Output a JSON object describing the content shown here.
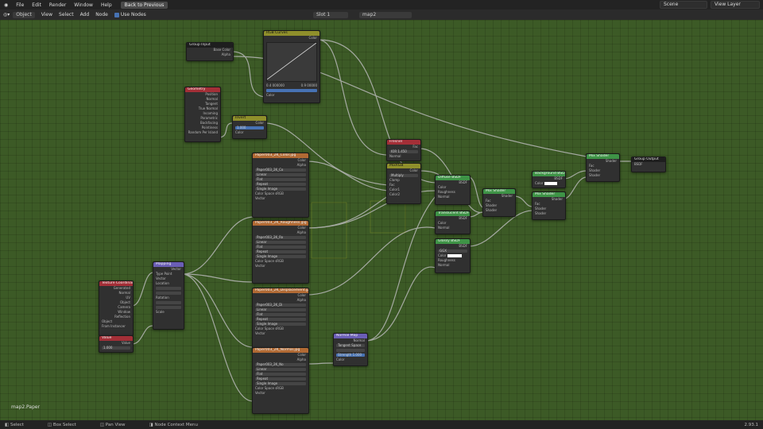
{
  "menu": {
    "items": [
      "File",
      "Edit",
      "Render",
      "Window",
      "Help"
    ],
    "back_button": "Back to Previous"
  },
  "topright": {
    "scene": "Scene",
    "view_layer": "View Layer"
  },
  "header": {
    "mode": "Object",
    "items": [
      "View",
      "Select",
      "Add",
      "Node"
    ],
    "use_nodes": "Use Nodes",
    "slot": "Slot 1",
    "material": "map2"
  },
  "nodes": {
    "group_input": {
      "title": "Group Input",
      "rows": [
        "Base Color",
        "Alpha"
      ]
    },
    "rgb_curves": {
      "title": "RGB Curves",
      "rows": [
        "Color",
        "Fac",
        "Color"
      ],
      "left": "0.4 000000",
      "right": "0.9 00000"
    },
    "geometry": {
      "title": "Geometry",
      "rows": [
        "Position",
        "Normal",
        "Tangent",
        "True Normal",
        "Incoming",
        "Parametric",
        "Backfacing",
        "Pointiness",
        "Random Per Island"
      ]
    },
    "invert": {
      "title": "Invert",
      "rows": [
        "Color",
        "Fac",
        "Color"
      ],
      "fac": "1.000"
    },
    "tex1": {
      "title": "Paper003_2K_Color.jpg",
      "rows": [
        "Color",
        "Alpha",
        "Paper003_2K_Co",
        "Linear",
        "Flat",
        "Repeat",
        "Single Image",
        "Color Space",
        "sRGB",
        "Vector"
      ]
    },
    "tex2": {
      "title": "Paper003_2K_Roughness.jpg",
      "rows": [
        "Color",
        "Alpha",
        "Paper003_2K_Ro",
        "Linear",
        "Flat",
        "Repeat",
        "Single Image",
        "Color Space",
        "sRGB",
        "Vector"
      ]
    },
    "tex3": {
      "title": "Paper003_2K_Displacement.jpg",
      "rows": [
        "Color",
        "Alpha",
        "Paper003_2K_Di",
        "Linear",
        "Flat",
        "Repeat",
        "Single Image",
        "Color Space",
        "sRGB",
        "Vector"
      ]
    },
    "tex4": {
      "title": "Paper003_2K_Normal.jpg",
      "rows": [
        "Color",
        "Alpha",
        "Paper003_2K_No",
        "Linear",
        "Flat",
        "Repeat",
        "Single Image",
        "Color Space",
        "sRGB",
        "Vector"
      ]
    },
    "texcoord": {
      "title": "Texture Coordinate",
      "rows": [
        "Generated",
        "Normal",
        "UV",
        "Object",
        "Camera",
        "Window",
        "Reflection",
        "Object",
        "From Instancer"
      ]
    },
    "value": {
      "title": "Value",
      "rows": [
        "Value",
        "1.000"
      ]
    },
    "mapping": {
      "title": "Mapping",
      "rows": [
        "Vector",
        "Type",
        "Point",
        "Vector",
        "Location",
        "Rotation",
        "Scale"
      ]
    },
    "fresnel": {
      "title": "Fresnel",
      "rows": [
        "Fac",
        "IOR",
        "1.450",
        "Normal"
      ]
    },
    "mixrgb": {
      "title": "MixRGB",
      "rows": [
        "Color",
        "Multiply",
        "Clamp",
        "Fac",
        "Color1",
        "Color2"
      ]
    },
    "diffuse": {
      "title": "Diffuse BSDF",
      "rows": [
        "BSDF",
        "Color",
        "Roughness",
        "Normal"
      ]
    },
    "translucent": {
      "title": "Translucent BSDF",
      "rows": [
        "BSDF",
        "Color",
        "Normal"
      ]
    },
    "glossy": {
      "title": "Glossy BSDF",
      "rows": [
        "BSDF",
        "GGX",
        "Color",
        "Roughness",
        "Normal"
      ]
    },
    "mix1": {
      "title": "Mix Shader",
      "rows": [
        "Shader",
        "Fac",
        "Shader",
        "Shader"
      ]
    },
    "mix2": {
      "title": "Mix Shader",
      "rows": [
        "Shader",
        "Fac",
        "Shader",
        "Shader"
      ]
    },
    "mix3": {
      "title": "Mix Shader",
      "rows": [
        "Shader",
        "Fac",
        "Shader",
        "Shader"
      ]
    },
    "bg": {
      "title": "Background BSDF",
      "rows": [
        "BSDF",
        "Color"
      ]
    },
    "normalmap": {
      "title": "Normal Map",
      "rows": [
        "Normal",
        "Tangent Space",
        "Strength",
        "1.000",
        "Color"
      ]
    },
    "group_output": {
      "title": "Group Output",
      "rows": [
        "BSDF"
      ]
    }
  },
  "canvas_label": "map2.Paper",
  "footer": {
    "select": "Select",
    "box_select": "Box Select",
    "pan_view": "Pan View",
    "context": "Node Context Menu",
    "version": "2.93.1"
  }
}
